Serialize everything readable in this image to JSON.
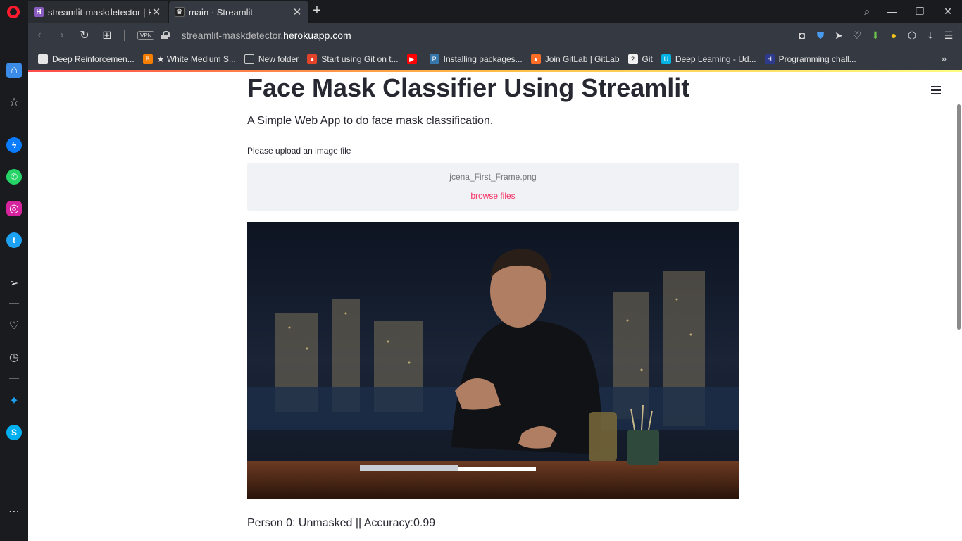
{
  "tabs": [
    {
      "title": "streamlit-maskdetector | He",
      "icon": "heroku-icon",
      "active": false
    },
    {
      "title": "main · Streamlit",
      "icon": "streamlit-icon",
      "active": true
    }
  ],
  "address": {
    "url_prefix": "streamlit-maskdetector.",
    "url_domain": "herokuapp.com",
    "vpn": "VPN"
  },
  "bookmarks": [
    {
      "label": "Deep Reinforcemen...",
      "icon": "page-icon",
      "color": "#e6e6e6"
    },
    {
      "label": "★ White Medium S...",
      "icon": "blogger-icon",
      "color": "#f57d00"
    },
    {
      "label": "New folder",
      "icon": "folder-icon",
      "color": "#cccccc"
    },
    {
      "label": "Start using Git on t...",
      "icon": "gitlab-icon",
      "color": "#e24329"
    },
    {
      "label": "",
      "icon": "youtube-icon",
      "color": "#ff0000"
    },
    {
      "label": "Installing packages...",
      "icon": "python-icon",
      "color": "#3776ab"
    },
    {
      "label": "Join GitLab | GitLab",
      "icon": "gitlab-icon",
      "color": "#fc6d26"
    },
    {
      "label": "Git",
      "icon": "git-icon",
      "color": "#f1f1f1"
    },
    {
      "label": "Deep Learning - Ud...",
      "icon": "udacity-icon",
      "color": "#02b3e4"
    },
    {
      "label": "Programming chall...",
      "icon": "hackerrank-icon",
      "color": "#2e3a8c"
    }
  ],
  "app": {
    "title": "Face Mask Classifier Using Streamlit",
    "subtitle": "A Simple Web App to do face mask classification.",
    "upload_label": "Please upload an image file",
    "uploaded_filename": "jcena_First_Frame.png",
    "browse_label": "browse files",
    "result_text": "Person 0: Unmasked || Accuracy:0.99"
  },
  "colors": {
    "accent": "#f63366",
    "text": "#262730",
    "dropzone_bg": "#f0f2f6",
    "browser_chrome": "#343942"
  }
}
